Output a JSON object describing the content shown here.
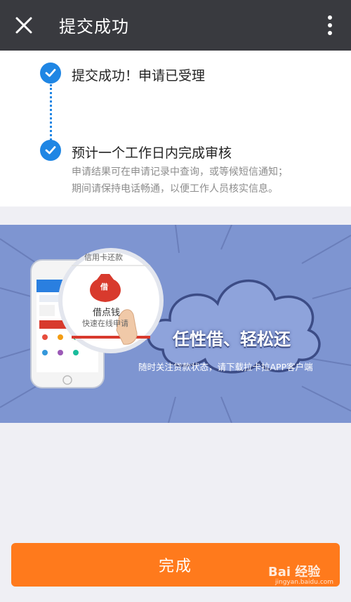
{
  "header": {
    "title": "提交成功",
    "close_icon": "close-icon",
    "more_icon": "more-vertical-icon"
  },
  "steps": [
    {
      "title": "提交成功！申请已受理",
      "icon": "check-circle-icon"
    },
    {
      "title": "预计一个工作日内完成审核",
      "icon": "check-circle-icon",
      "desc_line1": "申请结果可在申请记录中查询，或等候短信通知；",
      "desc_line2": "期间请保持电话畅通，以便工作人员核实信息。"
    }
  ],
  "banner": {
    "headline": "任性借、轻松还",
    "subtext": "随时关注贷款状态，请下载拉卡拉APP客户端",
    "magnifier_top": "信用卡还款",
    "magnifier_main": "借点钱",
    "magnifier_sub": "快速在线申请",
    "bag_char": "借"
  },
  "footer": {
    "done_label": "完成"
  },
  "watermark": {
    "text": "Bai 经验",
    "sub": "jingyan.baidu.com"
  },
  "colors": {
    "topbar": "#393a3f",
    "accent_blue": "#1f86e4",
    "banner_bg": "#7e95d1",
    "button_orange": "#ff7a1c"
  }
}
